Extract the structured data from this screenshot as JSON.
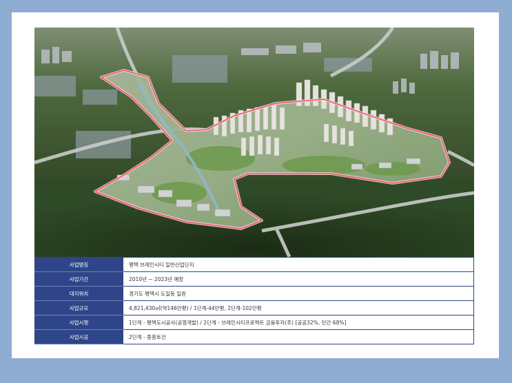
{
  "image": {
    "subject": "aerial-rendering-of-industrial-complex"
  },
  "info_table": {
    "rows": [
      {
        "label": "사업명칭",
        "value": "평택 브레인시티 일반산업단지"
      },
      {
        "label": "사업기간",
        "value": "2010년 ~ 2023년 예정"
      },
      {
        "label": "대지위치",
        "value": "경기도 평택시 도일동 일원"
      },
      {
        "label": "사업규모",
        "value": "4,821,430㎡(약146만평) / 1단계-44만평, 2단계-102만평"
      },
      {
        "label": "사업시행",
        "value": "1단계 - 평택도시공사(공영개발) / 2단계 - 브레인시티프로젝트 금융투자(주) [공공32%, 민간 68%]"
      },
      {
        "label": "사업시공",
        "value": "2단계 - 중흥토건"
      }
    ]
  },
  "colors": {
    "background": "#8facd2",
    "card": "#ffffff",
    "label_cell": "#2e4589",
    "border": "#2f4380",
    "boundary_line": "#e8596d"
  }
}
